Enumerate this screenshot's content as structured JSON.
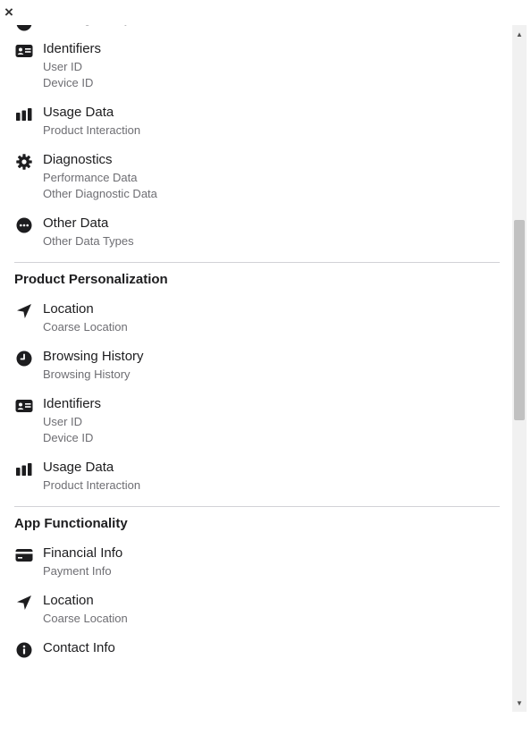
{
  "close_label": "×",
  "scrollbar": {
    "up_arrow": "▲",
    "down_arrow": "▼"
  },
  "groups": [
    {
      "title": "",
      "categories": [
        {
          "name": "",
          "icon": "clock-icon",
          "items": [
            "Browsing History"
          ]
        },
        {
          "name": "Identifiers",
          "icon": "id-card-icon",
          "items": [
            "User ID",
            "Device ID"
          ]
        },
        {
          "name": "Usage Data",
          "icon": "bar-chart-icon",
          "items": [
            "Product Interaction"
          ]
        },
        {
          "name": "Diagnostics",
          "icon": "gear-icon",
          "items": [
            "Performance Data",
            "Other Diagnostic Data"
          ]
        },
        {
          "name": "Other Data",
          "icon": "ellipsis-icon",
          "items": [
            "Other Data Types"
          ]
        }
      ]
    },
    {
      "title": "Product Personalization",
      "categories": [
        {
          "name": "Location",
          "icon": "location-arrow-icon",
          "items": [
            "Coarse Location"
          ]
        },
        {
          "name": "Browsing History",
          "icon": "clock-icon",
          "items": [
            "Browsing History"
          ]
        },
        {
          "name": "Identifiers",
          "icon": "id-card-icon",
          "items": [
            "User ID",
            "Device ID"
          ]
        },
        {
          "name": "Usage Data",
          "icon": "bar-chart-icon",
          "items": [
            "Product Interaction"
          ]
        }
      ]
    },
    {
      "title": "App Functionality",
      "categories": [
        {
          "name": "Financial Info",
          "icon": "credit-card-icon",
          "items": [
            "Payment Info"
          ]
        },
        {
          "name": "Location",
          "icon": "location-arrow-icon",
          "items": [
            "Coarse Location"
          ]
        },
        {
          "name": "Contact Info",
          "icon": "info-icon",
          "items": []
        }
      ]
    }
  ]
}
